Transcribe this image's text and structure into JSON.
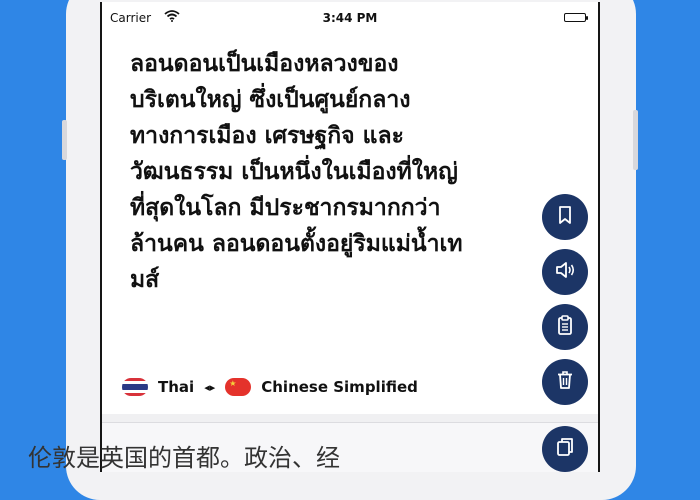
{
  "status_bar": {
    "carrier": "Carrier",
    "time": "3:44 PM"
  },
  "source": {
    "text": "ลอนดอนเป็นเมืองหลวงของ\nบริเตนใหญ่ ซึ่งเป็นศูนย์กลาง\nทางการเมือง เศรษฐกิจ และ\nวัฒนธรรม เป็นหนึ่งในเมืองที่ใหญ่\nที่สุดในโลก มีประชากรมากกว่า\nล้านคน ลอนดอนตั้งอยู่ริมแม่น้ำเท\nมส์"
  },
  "languages": {
    "from": "Thai",
    "to": "Chinese Simplified"
  },
  "target": {
    "text": "伦敦是英国的首都。政治、经"
  },
  "icons": {
    "bookmark": "bookmark-icon",
    "speaker": "speaker-icon",
    "clipboard": "clipboard-icon",
    "trash": "trash-icon",
    "copy": "copy-icon"
  },
  "colors": {
    "background": "#2f86e6",
    "fab": "#1c3566"
  }
}
